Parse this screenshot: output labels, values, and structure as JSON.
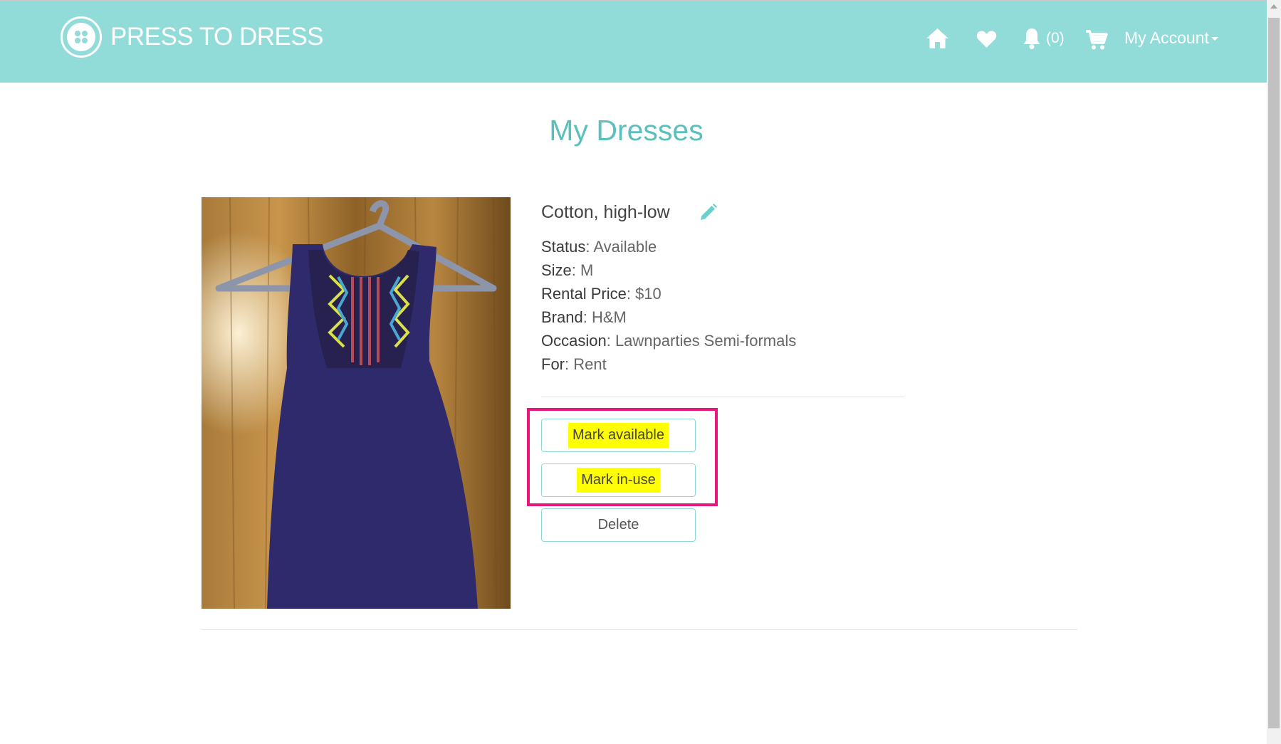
{
  "header": {
    "brand": "PRESS TO DRESS",
    "notifications_count": "(0)",
    "account_label": "My Account",
    "icons": [
      "home-icon",
      "heart-icon",
      "bell-icon",
      "cart-icon"
    ],
    "background_color": "#91dcd8"
  },
  "main": {
    "title": "My Dresses",
    "dress": {
      "name": "Cotton, high-low",
      "details": [
        {
          "label": "Status",
          "value": ": Available"
        },
        {
          "label": "Size",
          "value": ": M"
        },
        {
          "label": "Rental Price",
          "value": ": $10"
        },
        {
          "label": "Brand",
          "value": ": H&M"
        },
        {
          "label": "Occasion",
          "value": ": Lawnparties Semi-formals"
        },
        {
          "label": "For",
          "value": ": Rent"
        }
      ],
      "actions": {
        "mark_available": "Mark available",
        "mark_in_use": "Mark in-use",
        "delete": "Delete"
      }
    },
    "accent_color": "#5bbfbc",
    "highlight_color": "#ffff00",
    "annotation_box_color": "#e8177e"
  }
}
